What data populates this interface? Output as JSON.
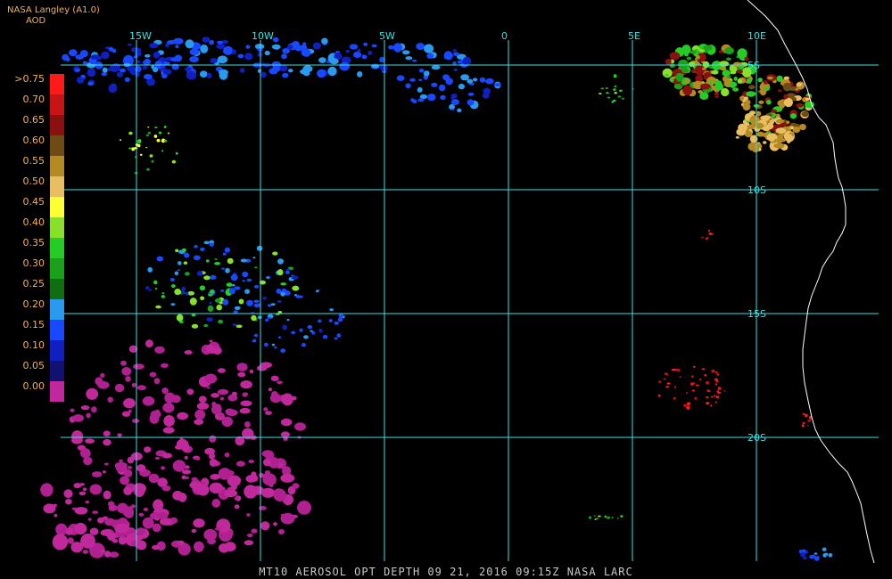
{
  "header": {
    "org_label": "NASA Langley (A1.0)",
    "product_label": "AOD"
  },
  "legend": {
    "labels": [
      ">0.75",
      "0.70",
      "0.65",
      "0.60",
      "0.55",
      "0.50",
      "0.45",
      "0.40",
      "0.35",
      "0.30",
      "0.25",
      "0.20",
      "0.15",
      "0.10",
      "0.05",
      "0.00"
    ],
    "colors": [
      "#ff1a1a",
      "#c81414",
      "#8c1010",
      "#6e4a14",
      "#b48a22",
      "#e8be60",
      "#ffff33",
      "#88e02a",
      "#26cc26",
      "#1aa01a",
      "#0f6e0f",
      "#2a9aee",
      "#1848ff",
      "#1020c0",
      "#121070",
      "#c0289c"
    ]
  },
  "grid": {
    "lon_labels": [
      "15W",
      "10W",
      "5W",
      "0",
      "5E",
      "10E"
    ],
    "lat_labels": [
      "5S",
      "10S",
      "15S",
      "20S"
    ]
  },
  "footer": {
    "text": "MT10  AEROSOL OPT DEPTH   09 21, 2016 09:15Z   NASA LARC"
  },
  "style": {
    "grid_color": "#40e0e0",
    "coast_color": "#ffffff",
    "text_color": "#f0b060"
  }
}
